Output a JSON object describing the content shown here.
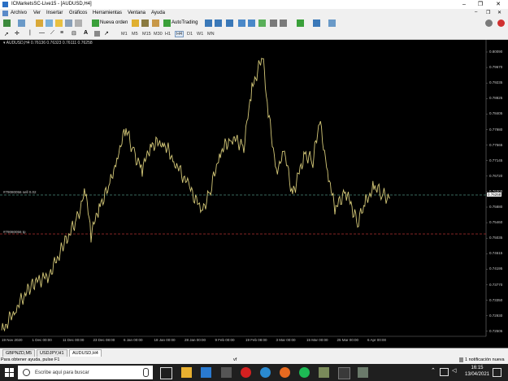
{
  "window": {
    "title": "ICMarketsSC-Live15 - [AUDUSD,H4]",
    "controls": [
      "–",
      "❐",
      "✕"
    ]
  },
  "menu": {
    "items": [
      "Archivo",
      "Ver",
      "Insertar",
      "Gráficos",
      "Herramientas",
      "Ventana",
      "Ayuda"
    ]
  },
  "toolbar": {
    "new_order_label": "Nueva orden",
    "autotrading_label": "AutoTrading",
    "timeframes": [
      "M1",
      "M5",
      "M15",
      "M30",
      "H1",
      "H4",
      "D1",
      "W1",
      "MN"
    ],
    "active_timeframe": "H4"
  },
  "chart": {
    "symbol_info": "▾ AUDUSD,H4  0.76136 0.76323 0.76111 0.76258",
    "line_sl_label": "#79080056 sell 0.02",
    "line_tp_label": "#79080056 tp",
    "current_price": "0.76258",
    "y_ticks": [
      "0.80090",
      "0.79670",
      "0.79235",
      "0.78825",
      "0.78405",
      "0.77980",
      "0.77565",
      "0.77145",
      "0.76720",
      "0.76300",
      "0.75880",
      "0.75460",
      "0.75035",
      "0.74615",
      "0.74195",
      "0.73770",
      "0.73350",
      "0.72930",
      "0.72505"
    ],
    "x_ticks": [
      "19 Nov 2020",
      "1 Dec 00:00",
      "11 Dec 00:00",
      "23 Dec 08:00",
      "6 Jan 00:00",
      "18 Jan 00:00",
      "28 Jan 00:00",
      "9 Feb 00:00",
      "19 Feb 08:00",
      "3 Mar 00:00",
      "15 Mar 00:00",
      "25 Mar 00:00",
      "6 Apr 00:00"
    ],
    "colors": {
      "background": "#000000",
      "candles": "#d4c878",
      "sell_line": "#4a8a7a",
      "tp_line": "#b03030",
      "axis_text": "#c8c8c8"
    }
  },
  "tabs": {
    "items": [
      "GBPNZD,M5",
      "USDJPY,H1",
      "AUDUSD,H4"
    ],
    "active": "AUDUSD,H4"
  },
  "status": {
    "help_text": "Para obtener ayuda, pulse F1",
    "mid_text": "vf",
    "notification_text": "1 notificación nueva"
  },
  "taskbar": {
    "search_placeholder": "Escribe aquí para buscar",
    "time": "16:15",
    "date": "13/04/2021",
    "icons": [
      "windows-start-icon",
      "task-view-icon",
      "file-explorer-icon",
      "mail-icon",
      "store-icon",
      "opera-icon",
      "edge-icon",
      "firefox-icon",
      "spotify-icon",
      "metatrader-icon",
      "app-icon",
      "terminal-icon"
    ]
  }
}
